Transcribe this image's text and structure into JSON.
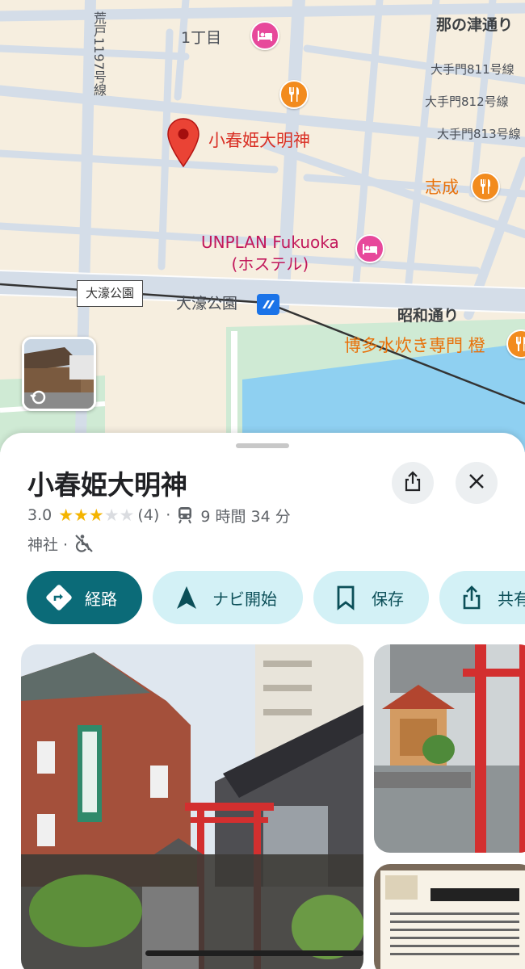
{
  "map": {
    "labels": {
      "chome": "1丁目",
      "street_nanotsu": "那の津通り",
      "street_arato": "荒戸1197号線",
      "street_811": "大手門811号線",
      "street_812": "大手門812号線",
      "street_813": "大手門813号線",
      "place_pin": "小春姫大明神",
      "shisei": "志成",
      "hostel": "UNPLAN Fukuoka\n(ホステル)",
      "station_box": "大濠公園",
      "station_main": "大濠公園",
      "street_showa": "昭和通り",
      "hakata": "博多水炊き専門 橙"
    },
    "colors": {
      "land": "#f6eedf",
      "road": "#d4dde8",
      "water": "#8fd0f1",
      "park": "#cfead4",
      "pin": "#ea4335"
    }
  },
  "place": {
    "title": "小春姫大明神",
    "rating": "3.0",
    "stars_filled": 3,
    "stars_total": 5,
    "review_count": "(4)",
    "separator": "·",
    "transit_time": "9 時間 34 分",
    "category": "神社 ·"
  },
  "icons": {
    "share": "share-icon",
    "close": "close-icon",
    "train": "train-icon",
    "wheelchair": "no-wheelchair-icon",
    "directions": "directions-icon",
    "navigate": "navigation-arrow-icon",
    "save": "bookmark-icon",
    "share_chip": "share-icon"
  },
  "actions": {
    "directions": "経路",
    "start": "ナビ開始",
    "save": "保存",
    "share": "共有"
  },
  "colors": {
    "primary": "#0b6b78",
    "secondary_bg": "#d3f1f6",
    "star": "#f4b400",
    "star_empty": "#dadce0"
  }
}
